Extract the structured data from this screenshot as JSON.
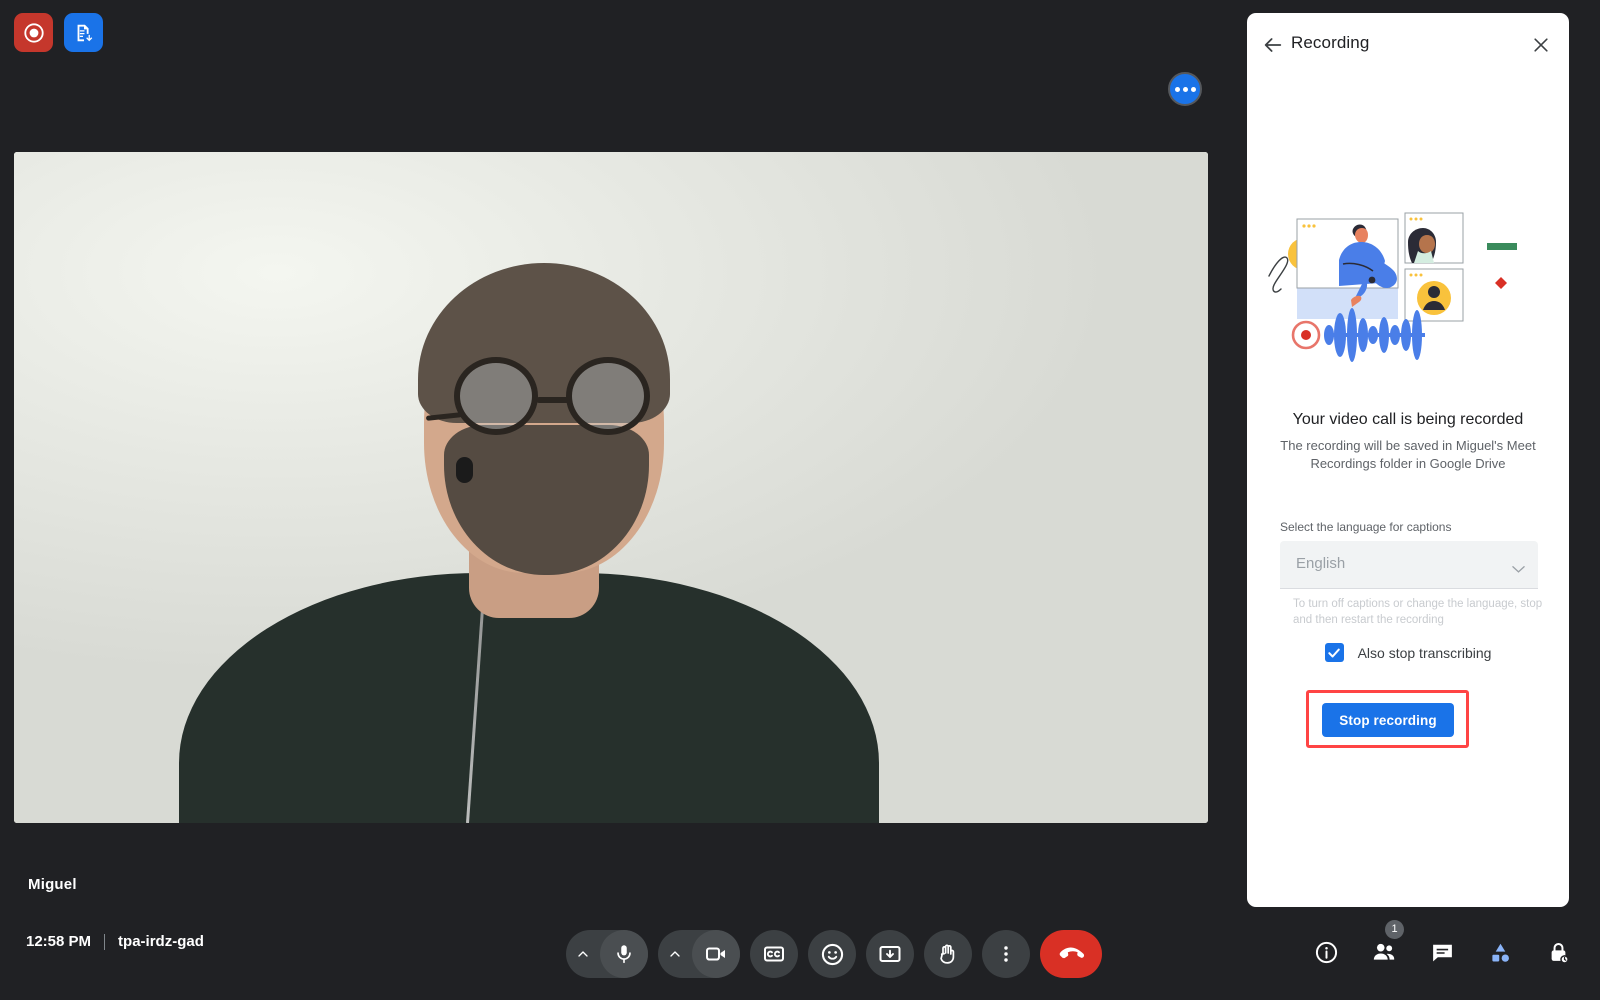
{
  "app": {
    "name": "Google Meet",
    "background_color": "#202124"
  },
  "stage": {
    "status_chips": [
      {
        "name": "recording-indicator",
        "icon": "record-dot-icon",
        "color": "#C5372C"
      },
      {
        "name": "transcription-indicator",
        "icon": "transcript-document-icon",
        "color": "#1A73E8"
      }
    ],
    "more_options_button": {
      "icon": "more-horizontal-icon",
      "color": "#1A73E8"
    },
    "participant": {
      "name": "Miguel"
    }
  },
  "bottom_bar": {
    "time": "12:58 PM",
    "meeting_code": "tpa-irdz-gad",
    "controls": [
      {
        "name": "microphone-button",
        "icon": "microphone-icon",
        "has_chevron": true
      },
      {
        "name": "camera-button",
        "icon": "video-camera-icon",
        "has_chevron": true
      },
      {
        "name": "captions-button",
        "icon": "closed-captions-icon",
        "has_chevron": false
      },
      {
        "name": "emoji-button",
        "icon": "emoji-smiley-icon",
        "has_chevron": false
      },
      {
        "name": "present-button",
        "icon": "present-screen-icon",
        "has_chevron": false
      },
      {
        "name": "raise-hand-button",
        "icon": "raised-hand-icon",
        "has_chevron": false
      },
      {
        "name": "more-options-button",
        "icon": "more-vertical-icon",
        "has_chevron": false
      }
    ],
    "end_call": {
      "label": "",
      "icon": "end-call-phone-icon",
      "color": "#D93025"
    },
    "right_controls": [
      {
        "name": "meeting-details-button",
        "icon": "info-circle-icon",
        "badge": ""
      },
      {
        "name": "people-button",
        "icon": "people-icon",
        "badge": "1"
      },
      {
        "name": "chat-button",
        "icon": "chat-bubble-icon",
        "badge": ""
      },
      {
        "name": "activities-button",
        "icon": "activities-shapes-icon",
        "badge": ""
      },
      {
        "name": "host-controls-button",
        "icon": "lock-shield-icon",
        "badge": ""
      }
    ]
  },
  "panel": {
    "title": "Recording",
    "back_icon": "back-arrow-icon",
    "close_icon": "close-x-icon",
    "heading": "Your video call is being recorded",
    "subtext": "The recording will be saved in Miguel's Meet Recordings folder in Google Drive",
    "caption_label": "Select the language for captions",
    "caption_selected": "English",
    "caption_help": "To turn off captions or change the language, stop and then restart the recording",
    "transcribe_label": "Also stop transcribing",
    "transcribe_checked": true,
    "stop_button_label": "Stop recording",
    "accent_color": "#1A73E8",
    "annotation_color": "#FF4444"
  }
}
